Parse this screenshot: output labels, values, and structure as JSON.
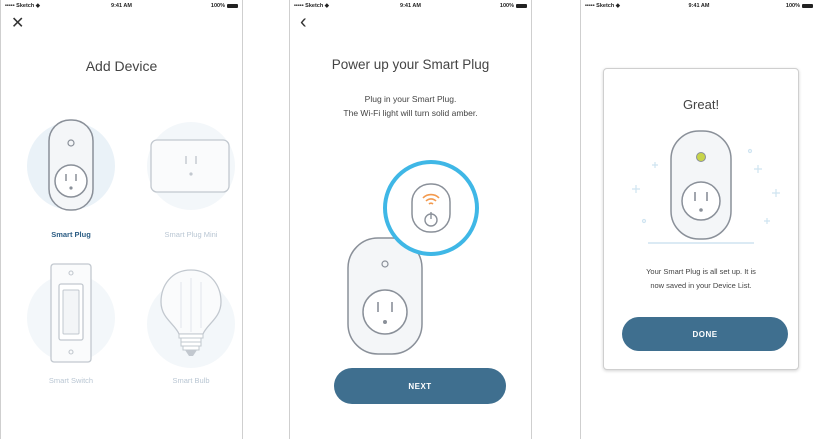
{
  "status_bar": {
    "carrier": "••••• Sketch ◆",
    "time": "9:41 AM",
    "battery": "100%"
  },
  "screen1": {
    "close_icon": "✕",
    "title": "Add Device",
    "devices": [
      {
        "label": "Smart Plug",
        "icon": "smart-plug-icon",
        "selected": true
      },
      {
        "label": "Smart Plug Mini",
        "icon": "smart-plug-mini-icon",
        "selected": false
      },
      {
        "label": "Smart Switch",
        "icon": "smart-switch-icon",
        "selected": false
      },
      {
        "label": "Smart Bulb",
        "icon": "smart-bulb-icon",
        "selected": false
      }
    ]
  },
  "screen2": {
    "back_icon": "‹",
    "title": "Power up your Smart Plug",
    "subtitle_line1": "Plug in your Smart Plug.",
    "subtitle_line2": "The Wi-Fi light will turn solid amber.",
    "next_label": "NEXT"
  },
  "screen3": {
    "title": "Great!",
    "message_line1": "Your Smart Plug is all set up. It is",
    "message_line2": "now saved in your Device List.",
    "done_label": "DONE"
  },
  "colors": {
    "accent": "#3f6f8f",
    "selected_label": "#2c5d84",
    "inactive_label": "#b9c6d3",
    "highlight_ring": "#3fb7e6",
    "wifi_amber": "#f39a4e",
    "status_led": "#c7d44a"
  }
}
